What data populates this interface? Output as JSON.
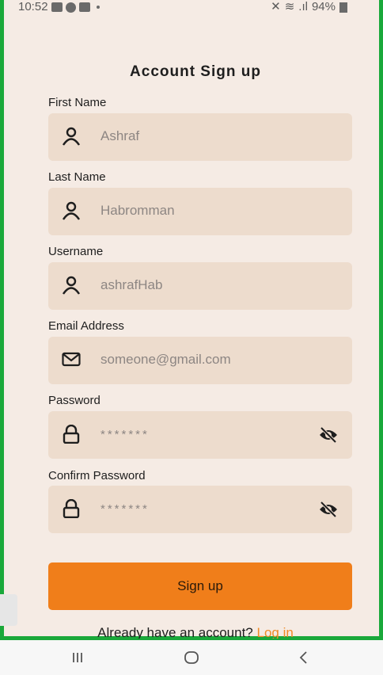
{
  "status": {
    "time": "10:52",
    "battery": "94%"
  },
  "title": "Account Sign up",
  "fields": [
    {
      "label": "First Name",
      "value": "Ashraf",
      "icon": "person-icon"
    },
    {
      "label": "Last Name",
      "value": "Habromman",
      "icon": "person-icon"
    },
    {
      "label": "Username",
      "value": "ashrafHab",
      "icon": "person-icon"
    },
    {
      "label": "Email Address",
      "value": "someone@gmail.com",
      "icon": "mail-icon"
    },
    {
      "label": "Password",
      "value": "*******",
      "icon": "lock-icon"
    },
    {
      "label": "Confirm Password",
      "value": "*******",
      "icon": "lock-icon"
    }
  ],
  "signup_button": "Sign up",
  "login_prompt": "Already have an account?",
  "login_link": "Log in",
  "colors": {
    "accent": "#f07e1a",
    "field_bg": "#eddccd",
    "page_bg": "#f5ebe4",
    "frame": "#1aa83a"
  }
}
